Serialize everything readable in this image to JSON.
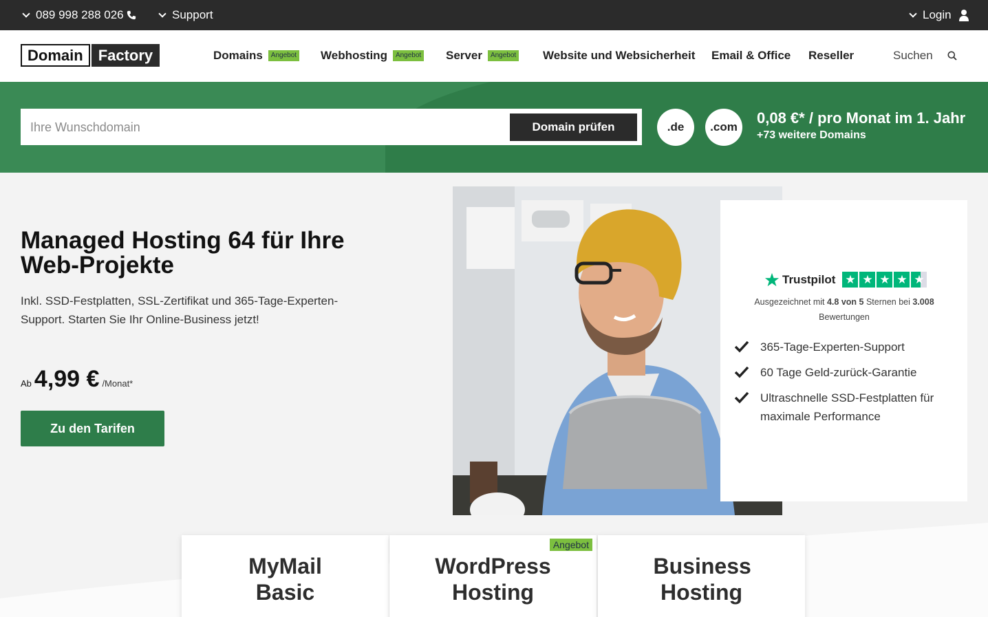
{
  "topbar": {
    "phone": "089 998 288 026",
    "support": "Support",
    "login": "Login"
  },
  "header": {
    "logo": {
      "part1": "Domain",
      "part2": "Factory"
    },
    "nav": [
      {
        "label": "Domains",
        "badge": "Angebot"
      },
      {
        "label": "Webhosting",
        "badge": "Angebot"
      },
      {
        "label": "Server",
        "badge": "Angebot"
      },
      {
        "label": "Website und Websicherheit"
      },
      {
        "label": "Email & Office"
      },
      {
        "label": "Reseller"
      }
    ],
    "search_label": "Suchen"
  },
  "domain_bar": {
    "placeholder": "Ihre Wunschdomain",
    "button": "Domain prüfen",
    "tlds": [
      ".de",
      ".com"
    ],
    "price_text": "0,08 €* / pro Monat im 1. Jahr",
    "more_text": "+73 weitere Domains"
  },
  "hero": {
    "title": "Managed Hosting 64 für Ihre Web-Projekte",
    "subtitle": "Inkl. SSD-Festplatten, SSL-Zertifikat und 365-Tage-Experten-Support. Starten Sie Ihr Online-Business jetzt!",
    "price_prefix": "Ab",
    "price": "4,99 €",
    "price_suffix": "/Monat*",
    "cta": "Zu den Tarifen"
  },
  "trust": {
    "brand": "Trustpilot",
    "rating_text_1": "Ausgezeichnet mit",
    "rating_value": "4.8 von 5",
    "rating_text_2": "Sternen bei",
    "rating_count": "3.008",
    "rating_text_3": "Bewertungen",
    "stars": 4.8,
    "features": [
      "365-Tage-Experten-Support",
      "60 Tage Geld-zurück-Garantie",
      "Ultraschnelle SSD-Festplatten für maximale Performance"
    ]
  },
  "tariffs": [
    {
      "name": "MyMail Basic"
    },
    {
      "name": "WordPress Hosting",
      "badge": "Angebot"
    },
    {
      "name": "Business Hosting"
    }
  ],
  "colors": {
    "topbar": "#2b2b2b",
    "green": "#3a8a55",
    "green_dark": "#2f7d49",
    "badge": "#7cbf3f",
    "trustpilot": "#00b67a"
  }
}
